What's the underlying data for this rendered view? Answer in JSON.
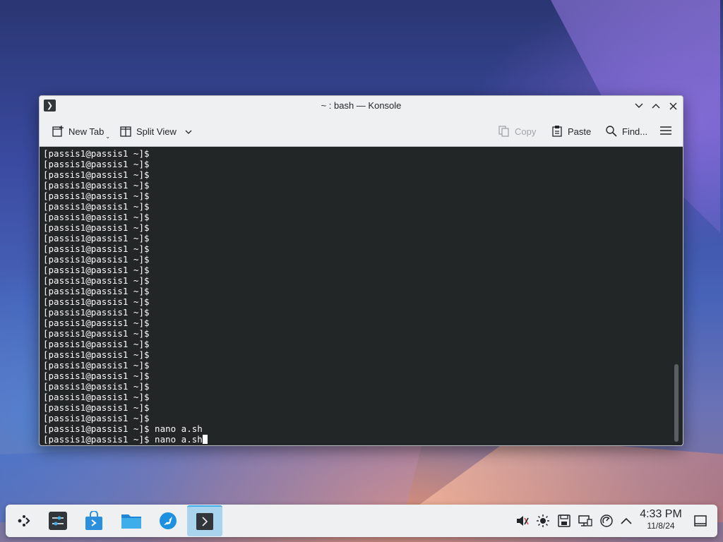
{
  "window": {
    "title": "~ : bash — Konsole",
    "app_icon": "terminal-icon"
  },
  "toolbar": {
    "new_tab_label": "New Tab",
    "split_view_label": "Split View",
    "copy_label": "Copy",
    "paste_label": "Paste",
    "find_label": "Find...",
    "menu_icon": "hamburger-menu-icon"
  },
  "terminal": {
    "lines": [
      "[passis1@passis1 ~]$",
      "[passis1@passis1 ~]$",
      "[passis1@passis1 ~]$",
      "[passis1@passis1 ~]$",
      "[passis1@passis1 ~]$",
      "[passis1@passis1 ~]$",
      "[passis1@passis1 ~]$",
      "[passis1@passis1 ~]$",
      "[passis1@passis1 ~]$",
      "[passis1@passis1 ~]$",
      "[passis1@passis1 ~]$",
      "[passis1@passis1 ~]$",
      "[passis1@passis1 ~]$",
      "[passis1@passis1 ~]$",
      "[passis1@passis1 ~]$",
      "[passis1@passis1 ~]$",
      "[passis1@passis1 ~]$",
      "[passis1@passis1 ~]$",
      "[passis1@passis1 ~]$",
      "[passis1@passis1 ~]$",
      "[passis1@passis1 ~]$",
      "[passis1@passis1 ~]$",
      "[passis1@passis1 ~]$",
      "[passis1@passis1 ~]$",
      "[passis1@passis1 ~]$",
      "[passis1@passis1 ~]$",
      "[passis1@passis1 ~]$ nano a.sh",
      "[passis1@passis1 ~]$ nano a.sh"
    ],
    "background": "#232627",
    "foreground": "#fcfcfc"
  },
  "taskbar": {
    "items": [
      {
        "name": "application-launcher-icon"
      },
      {
        "name": "system-settings-icon"
      },
      {
        "name": "discover-store-icon"
      },
      {
        "name": "dolphin-file-manager-icon"
      },
      {
        "name": "web-browser-icon"
      },
      {
        "name": "konsole-terminal-icon",
        "active": true
      }
    ],
    "tray": [
      "volume-muted-icon",
      "brightness-icon",
      "storage-device-icon",
      "network-icon",
      "update-notifier-icon",
      "show-hidden-icons-chevron-icon"
    ],
    "clock": {
      "time": "4:33 PM",
      "date": "11/8/24"
    },
    "show_desktop_icon": "show-desktop-icon"
  },
  "colors": {
    "accent": "#3daee9",
    "window_bg": "#eff0f1",
    "text": "#232629"
  }
}
